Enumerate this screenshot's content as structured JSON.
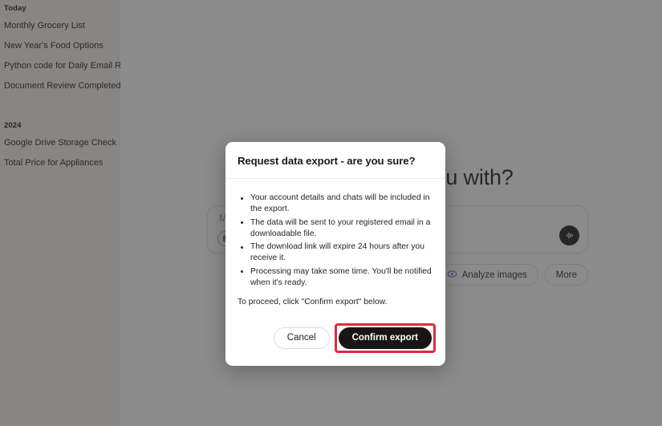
{
  "sidebar": {
    "sections": [
      {
        "label": "Today",
        "items": [
          "Monthly Grocery List",
          "New Year's Food Options",
          "Python code for Daily Email Report",
          "Document Review Completed"
        ]
      },
      {
        "label": "2024",
        "items": [
          "Google Drive Storage Check",
          "Total Price for Appliances"
        ]
      }
    ]
  },
  "main": {
    "greeting": "What can I help you with?",
    "composer": {
      "placeholder": "Message",
      "attach_icon": "paperclip-icon",
      "voice_icon": "voice-waveform-icon"
    },
    "suggestions": [
      {
        "label": "Analyze images",
        "icon": "eye-icon",
        "icon_color": "#6a5acd"
      },
      {
        "label": "More",
        "icon": ""
      }
    ]
  },
  "modal": {
    "title": "Request data export - are you sure?",
    "bullets": [
      "Your account details and chats will be included in the export.",
      "The data will be sent to your registered email in a downloadable file.",
      "The download link will expire 24 hours after you receive it.",
      "Processing may take some time. You'll be notified when it's ready."
    ],
    "proceed_text": "To proceed, click \"Confirm export\" below.",
    "cancel_label": "Cancel",
    "confirm_label": "Confirm export",
    "highlight_color": "#e02a3f"
  }
}
